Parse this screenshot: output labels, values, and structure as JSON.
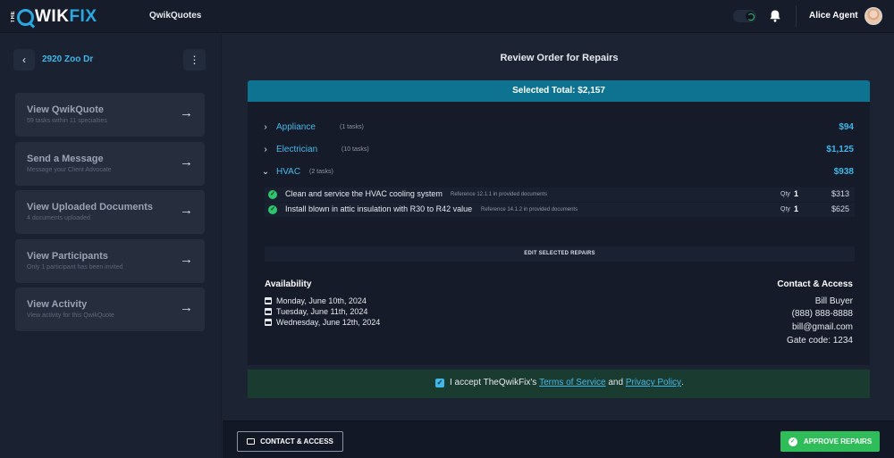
{
  "topbar": {
    "logo_the": "THE",
    "logo_wik": "WIK",
    "logo_fix": "FIX",
    "app_name": "QwikQuotes",
    "user_name": "Alice Agent"
  },
  "sidebar": {
    "property": "2920 Zoo Dr",
    "items": [
      {
        "title": "View QwikQuote",
        "subtitle": "59 tasks within 11 specialties"
      },
      {
        "title": "Send a Message",
        "subtitle": "Message your Client Advocate"
      },
      {
        "title": "View Uploaded Documents",
        "subtitle": "4 documents uploaded"
      },
      {
        "title": "View Participants",
        "subtitle": "Only 1 participant has been invited"
      },
      {
        "title": "View Activity",
        "subtitle": "View activity for this QwikQuote"
      }
    ]
  },
  "main": {
    "title": "Review Order for Repairs",
    "total_label": "Selected Total: $2,157",
    "categories": [
      {
        "name": "Appliance",
        "count": "(1 tasks)",
        "amount": "$94"
      },
      {
        "name": "Electrician",
        "count": "(10 tasks)",
        "amount": "$1,125"
      },
      {
        "name": "HVAC",
        "count": "(2 tasks)",
        "amount": "$938"
      }
    ],
    "tasks": [
      {
        "desc": "Clean and service the HVAC cooling system",
        "ref": "Reference 12.1.1 in provided documents",
        "qty_label": "Qty",
        "qty": "1",
        "price": "$313"
      },
      {
        "desc": "Install blown in attic insulation with R30 to R42 value",
        "ref": "Reference 14.1.2 in provided documents",
        "qty_label": "Qty",
        "qty": "1",
        "price": "$625"
      }
    ],
    "edit_label": "EDIT SELECTED REPAIRS",
    "availability": {
      "heading": "Availability",
      "dates": [
        "Monday, June 10th, 2024",
        "Tuesday, June 11th, 2024",
        "Wednesday, June 12th, 2024"
      ]
    },
    "contact": {
      "heading": "Contact & Access",
      "name": "Bill Buyer",
      "phone": "(888) 888-8888",
      "email": "bill@gmail.com",
      "gate": "Gate code: 1234"
    },
    "accept": {
      "prefix": "I accept TheQwikFix's",
      "terms": "Terms of Service",
      "and": "and",
      "privacy": "Privacy Policy",
      "suffix": "."
    }
  },
  "bottombar": {
    "contact_label": "CONTACT & ACCESS",
    "approve_label": "APPROVE REPAIRS"
  },
  "colors": {
    "accent_blue": "#3fb7e8",
    "banner_teal": "#0e7390",
    "approve_green": "#2ebd59",
    "check_green": "#2ec66e"
  }
}
